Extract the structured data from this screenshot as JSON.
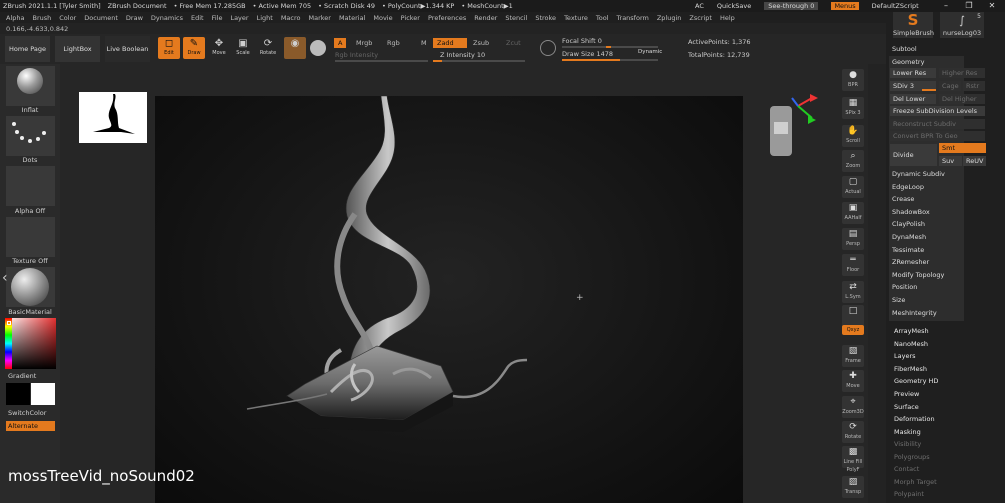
{
  "titlebar": {
    "app": "ZBrush 2021.1.1 [Tyler Smith]",
    "document": "ZBrush Document",
    "free_mem": "• Free Mem 17.285GB",
    "active_mem": "• Active Mem 705",
    "scratch": "• Scratch Disk 49",
    "polycount": "• PolyCount▶1.344 KP",
    "meshcount": "• MeshCount▶1",
    "ac": "AC",
    "quicksave": "QuickSave",
    "see_through": "See-through  0",
    "menus": "Menus",
    "script": "DefaultZScript"
  },
  "menubar": [
    "Alpha",
    "Brush",
    "Color",
    "Document",
    "Draw",
    "Dynamics",
    "Edit",
    "File",
    "Layer",
    "Light",
    "Macro",
    "Marker",
    "Material",
    "Movie",
    "Picker",
    "Preferences",
    "Render",
    "Stencil",
    "Stroke",
    "Texture",
    "Tool",
    "Transform",
    "Zplugin",
    "Zscript",
    "Help"
  ],
  "coord_readout": "0.166,-4.633,0.842",
  "toolbar": {
    "home_page": "Home Page",
    "lightbox": "LightBox",
    "live_boolean": "Live Boolean",
    "edit": "Edit",
    "draw": "Draw",
    "move": "Move",
    "scale": "Scale",
    "rotate": "Rotate",
    "a": "A",
    "mrgb": "Mrgb",
    "rgb": "Rgb",
    "m": "M",
    "zadd": "Zadd",
    "zsub": "Zsub",
    "zcut": "Zcut",
    "rgb_intensity": "Rgb Intensity",
    "z_intensity": "Z Intensity 10",
    "focal_shift": "Focal Shift 0",
    "draw_size": "Draw Size 1478",
    "dynamic": "Dynamic",
    "active_points": "ActivePoints: 1,376",
    "total_points": "TotalPoints: 12,739",
    "s_badge": "S"
  },
  "left_tray": {
    "brush": "Inflat",
    "stroke": "Dots",
    "alpha": "Alpha Off",
    "texture": "Texture Off",
    "material": "BasicMaterial",
    "gradient": "Gradient",
    "switchcolor": "SwitchColor",
    "alternate": "Alternate"
  },
  "right_shelf": [
    {
      "name": "bpr",
      "label": "BPR"
    },
    {
      "name": "spix",
      "label": "SPix 3"
    },
    {
      "name": "scroll",
      "label": "Scroll"
    },
    {
      "name": "zoom",
      "label": "Zoom"
    },
    {
      "name": "actual",
      "label": "Actual"
    },
    {
      "name": "aahalf",
      "label": "AAHalf"
    },
    {
      "name": "persp",
      "label": "Persp"
    },
    {
      "name": "floor",
      "label": "Floor"
    },
    {
      "name": "lsym",
      "label": "L.Sym"
    },
    {
      "name": "local",
      "label": ""
    },
    {
      "name": "xyz",
      "label": "Qxyz"
    },
    {
      "name": "frame",
      "label": "Frame"
    },
    {
      "name": "move",
      "label": "Move"
    },
    {
      "name": "zoom3d",
      "label": "Zoom3D"
    },
    {
      "name": "rotate",
      "label": "Rotate"
    },
    {
      "name": "linefill",
      "label": "Line Fill PolyF"
    },
    {
      "name": "transp",
      "label": "Transp"
    }
  ],
  "right_panel": {
    "brush1": "SimpleBrush",
    "brush2": "nurseLog03",
    "brush2_count": "5",
    "subtool": "Subtool",
    "geometry": "Geometry",
    "lower_res": "Lower Res",
    "higher_res": "Higher Res",
    "sdiv": "SDiv 3",
    "cage": "Cage",
    "rstr": "Rstr",
    "del_lower": "Del Lower",
    "del_higher": "Del Higher",
    "freeze": "Freeze SubDivision Levels",
    "reconstruct": "Reconstruct Subdiv",
    "convert_bpr": "Convert BPR To Geo",
    "divide": "Divide",
    "smt": "Smt",
    "suv": "Suv",
    "reuv": "ReUV",
    "items": [
      "Dynamic Subdiv",
      "EdgeLoop",
      "Crease",
      "ShadowBox",
      "ClayPolish",
      "DynaMesh",
      "Tessimate",
      "ZRemesher",
      "Modify Topology",
      "Position",
      "Size",
      "MeshIntegrity"
    ],
    "sections": [
      "ArrayMesh",
      "NanoMesh",
      "Layers",
      "FiberMesh",
      "Geometry HD",
      "Preview",
      "Surface",
      "Deformation",
      "Masking"
    ],
    "dim_sections": [
      "Visibility",
      "Polygroups",
      "Contact",
      "Morph Target",
      "Polypaint"
    ]
  },
  "overlay_title": "mossTreeVid_noSound02",
  "colors": {
    "accent": "#e47a1e",
    "panel": "#2d2d2d",
    "bg": "#232323"
  }
}
